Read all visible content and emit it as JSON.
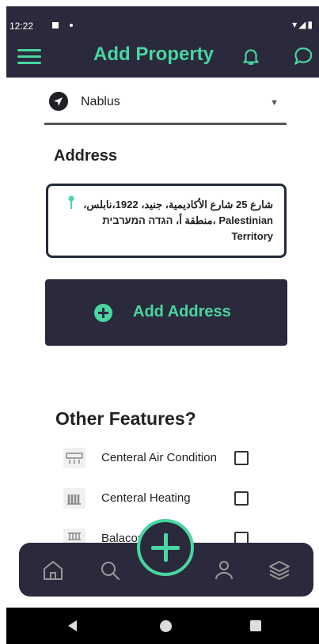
{
  "status_bar": {
    "time": "12:22",
    "icons": "▾◢▮"
  },
  "header": {
    "title": "Add Property"
  },
  "city_select": {
    "value": "Nablus"
  },
  "address": {
    "heading": "Address",
    "text": "شارع 25 شارع الأكاديمية، جنيد، 1922،نابلس، منطقة أ، הגדה המערבית، Palestinian Territory"
  },
  "add_address_button": {
    "label": "Add Address"
  },
  "features": {
    "heading": "Other Features?",
    "items": [
      {
        "label": "Centeral Air Condition",
        "checked": false
      },
      {
        "label": "Centeral Heating",
        "checked": false
      },
      {
        "label": "Balacony Terrace",
        "checked": false
      }
    ]
  },
  "bottom_nav": {
    "items": [
      "home-icon",
      "search-icon",
      "add-icon",
      "profile-icon",
      "layers-icon"
    ]
  },
  "colors": {
    "accent": "#49d6a1",
    "dark": "#2a2a3c"
  }
}
